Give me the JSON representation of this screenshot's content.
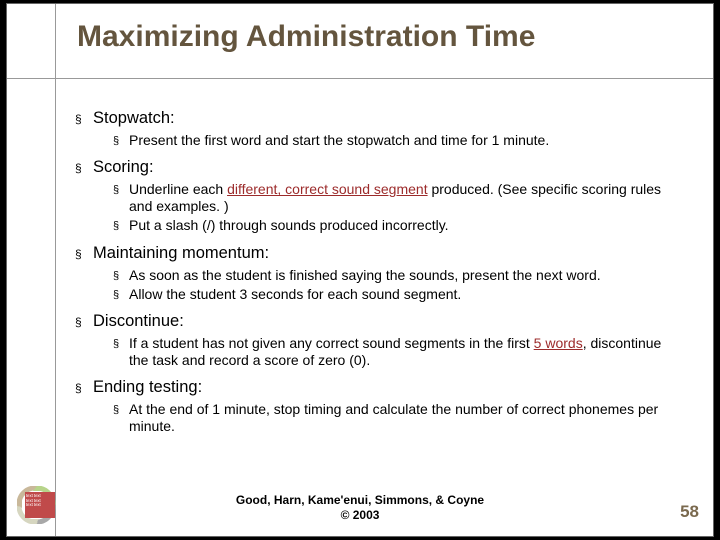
{
  "title": "Maximizing Administration Time",
  "sections": [
    {
      "heading": "Stopwatch:",
      "items": [
        {
          "pre": "Present the first word and start the stopwatch and time for 1 minute."
        }
      ]
    },
    {
      "heading": "Scoring:",
      "items": [
        {
          "pre": "Underline each ",
          "hl": "different, correct sound segment",
          "post": " produced. (See specific scoring rules and examples. )"
        },
        {
          "pre": "Put a slash (/) through sounds produced incorrectly."
        }
      ]
    },
    {
      "heading": "Maintaining momentum:",
      "items": [
        {
          "pre": "As soon as the student is finished saying the sounds, present the next word."
        },
        {
          "pre": "Allow the student 3 seconds for each sound segment."
        }
      ]
    },
    {
      "heading": "Discontinue:",
      "items": [
        {
          "pre": "If a student has not given any correct sound segments in the first ",
          "hl": "5 words",
          "post": ", discontinue the task and record a score of zero (0)."
        }
      ]
    },
    {
      "heading": "Ending testing:",
      "items": [
        {
          "pre": "At the end of 1 minute, stop timing and calculate the number of correct phonemes per minute."
        }
      ]
    }
  ],
  "footer": {
    "line1": "Good, Harn, Kame'enui, Simmons, & Coyne",
    "line2": "© 2003"
  },
  "pagenum": "58",
  "bullet1": "§",
  "bullet2": "§"
}
